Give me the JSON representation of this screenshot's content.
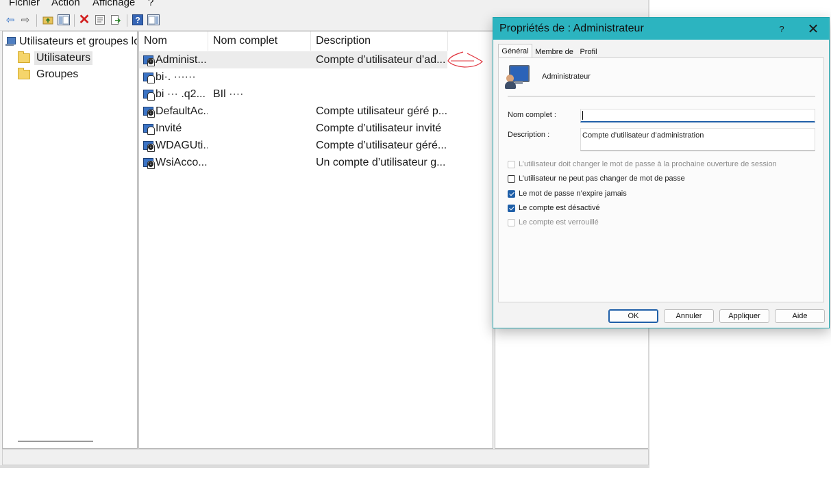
{
  "menu": {
    "items": [
      "Fichier",
      "Action",
      "Affichage",
      "?"
    ]
  },
  "toolbar": {
    "icons": [
      "back-arrow-icon",
      "forward-arrow-icon",
      "up-folder-icon",
      "show-hide-tree-icon",
      "delete-icon",
      "properties-icon",
      "export-list-icon",
      "help-icon",
      "action-pane-icon"
    ]
  },
  "tree": {
    "root_label": "Utilisateurs et groupes lo",
    "items": [
      {
        "label": "Utilisateurs",
        "selected": true
      },
      {
        "label": "Groupes",
        "selected": false
      }
    ]
  },
  "list": {
    "columns": [
      "Nom",
      "Nom complet",
      "Description"
    ],
    "rows": [
      {
        "name": "Administ...",
        "full_name": "",
        "description": "Compte d’utilisateur d’ad...",
        "selected": true,
        "disabled": true
      },
      {
        "name": "bi·. ······",
        "full_name": "",
        "description": "",
        "selected": false,
        "disabled": false
      },
      {
        "name": "bi ··· .q2...",
        "full_name": "BIl ····",
        "description": "",
        "selected": false,
        "disabled": false
      },
      {
        "name": "DefaultAc...",
        "full_name": "",
        "description": "Compte utilisateur géré p...",
        "selected": false,
        "disabled": true
      },
      {
        "name": "Invité",
        "full_name": "",
        "description": "Compte d’utilisateur invité",
        "selected": false,
        "disabled": false
      },
      {
        "name": "WDAGUti...",
        "full_name": "",
        "description": "Compte d’utilisateur géré...",
        "selected": false,
        "disabled": true
      },
      {
        "name": "WsiAcco...",
        "full_name": "",
        "description": "Un compte d’utilisateur g...",
        "selected": false,
        "disabled": true
      }
    ]
  },
  "dialog": {
    "title": "Propriétés de : Administrateur",
    "help_glyph": "?",
    "close_glyph": "✕",
    "tabs": [
      "Général",
      "Membre de",
      "Profil"
    ],
    "active_tab": "Général",
    "user_name": "Administrateur",
    "full_name_label": "Nom complet :",
    "full_name_value": "",
    "description_label": "Description :",
    "description_value": "Compte d’utilisateur d’administration",
    "checkboxes": [
      {
        "label": "L’utilisateur doit changer le mot de passe à la prochaine ouverture de session",
        "checked": false,
        "enabled": false
      },
      {
        "label": "L’utilisateur ne peut pas changer de mot de passe",
        "checked": false,
        "enabled": true
      },
      {
        "label": "Le mot de passe n’expire jamais",
        "checked": true,
        "enabled": true
      },
      {
        "label": "Le compte est désactivé",
        "checked": true,
        "enabled": true
      },
      {
        "label": "Le compte est verrouillé",
        "checked": false,
        "enabled": false
      }
    ],
    "buttons": {
      "ok": "OK",
      "cancel": "Annuler",
      "apply": "Appliquer",
      "help": "Aide"
    }
  },
  "colors": {
    "title_bar": "#2cb4c0",
    "accent": "#1f5fa8",
    "annotation": "#e0303a"
  }
}
